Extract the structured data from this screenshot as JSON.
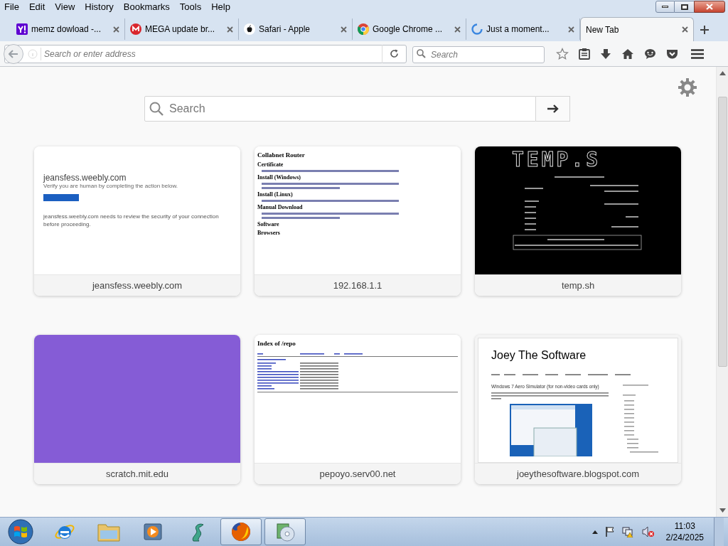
{
  "menu": [
    "File",
    "Edit",
    "View",
    "History",
    "Bookmarks",
    "Tools",
    "Help"
  ],
  "tabs": [
    {
      "title": "memz dowload -...",
      "kind": "yahoo",
      "selected": false
    },
    {
      "title": "MEGA update br...",
      "kind": "mega",
      "selected": false
    },
    {
      "title": "Safari - Apple",
      "kind": "apple",
      "selected": false
    },
    {
      "title": "Google Chrome ...",
      "kind": "chrome",
      "selected": false
    },
    {
      "title": "Just a moment...",
      "kind": "loading",
      "selected": false
    },
    {
      "title": "New Tab",
      "kind": "none",
      "selected": true
    }
  ],
  "address_bar": {
    "placeholder": "Search or enter address"
  },
  "search_bar": {
    "placeholder": "Search"
  },
  "page_search": {
    "placeholder": "Search"
  },
  "tiles": [
    {
      "caption": "jeansfess.weebly.com",
      "kind": "weebly",
      "heading": "jeansfess.weebly.com",
      "subtitle": "Verify you are human by completing the action below.",
      "note": "jeansfess.weebly.com needs to review the security of your connection before proceeding."
    },
    {
      "caption": "192.168.1.1",
      "kind": "router",
      "heading": "Collabnet Router",
      "sections": [
        "Certificate",
        "Install (Windows)",
        "Install (Linux)",
        "Manual Download",
        "Software",
        "Browsers"
      ]
    },
    {
      "caption": "temp.sh",
      "kind": "terminal",
      "heading": "TEMP.S"
    },
    {
      "caption": "scratch.mit.edu",
      "kind": "blank"
    },
    {
      "caption": "pepoyo.serv00.net",
      "kind": "index",
      "heading": "Index of /repo"
    },
    {
      "caption": "joeythesoftware.blogspot.com",
      "kind": "blog",
      "heading": "Joey The Software",
      "subtitle": "Windows 7 Aero Simulator (for non-video cards only)"
    }
  ],
  "taskbar": {
    "apps": [
      {
        "kind": "ie",
        "running": false
      },
      {
        "kind": "folder",
        "running": false
      },
      {
        "kind": "player",
        "running": false
      },
      {
        "kind": "dragon",
        "running": false
      },
      {
        "kind": "firefox",
        "running": true
      },
      {
        "kind": "disc",
        "running": true
      }
    ],
    "time": "11:03",
    "date": "2/24/2025"
  }
}
